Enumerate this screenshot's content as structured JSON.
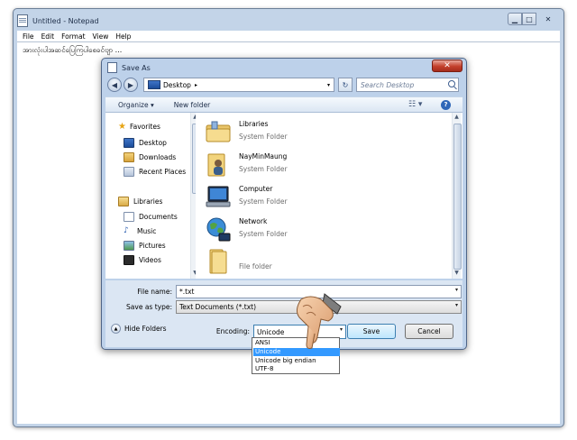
{
  "notepad": {
    "title": "Untitled - Notepad",
    "menu": [
      "File",
      "Edit",
      "Format",
      "View",
      "Help"
    ],
    "content": "အားလုံးပါအဆင်ပြေကြပါစေခင်ဗျာ ...",
    "caption_buttons": [
      "minimize",
      "maximize",
      "close"
    ]
  },
  "dialog": {
    "title": "Save As",
    "close_label": "✕",
    "address": "Desktop",
    "search_placeholder": "Search Desktop",
    "toolbar": {
      "organize": "Organize ▾",
      "new_folder": "New folder"
    },
    "nav": {
      "favorites": "Favorites",
      "favorites_items": [
        "Desktop",
        "Downloads",
        "Recent Places"
      ],
      "libraries": "Libraries",
      "libraries_items": [
        "Documents",
        "Music",
        "Pictures",
        "Videos"
      ]
    },
    "items": [
      {
        "name": "Libraries",
        "type": "System Folder",
        "icon": "libraries-icon"
      },
      {
        "name": "NayMinMaung",
        "type": "System Folder",
        "icon": "user-folder-icon"
      },
      {
        "name": "Computer",
        "type": "System Folder",
        "icon": "computer-icon"
      },
      {
        "name": "Network",
        "type": "System Folder",
        "icon": "network-icon"
      },
      {
        "name": "",
        "type": "File folder",
        "icon": "folder-icon"
      }
    ],
    "file_name_label": "File name:",
    "file_name_value": "*.txt",
    "save_as_type_label": "Save as type:",
    "save_as_type_value": "Text Documents (*.txt)",
    "hide_folders": "Hide Folders",
    "encoding_label": "Encoding:",
    "encoding_value": "Unicode",
    "encoding_options": [
      "ANSI",
      "Unicode",
      "Unicode big endian",
      "UTF-8"
    ],
    "encoding_selected": "Unicode",
    "save_label": "Save",
    "cancel_label": "Cancel"
  }
}
